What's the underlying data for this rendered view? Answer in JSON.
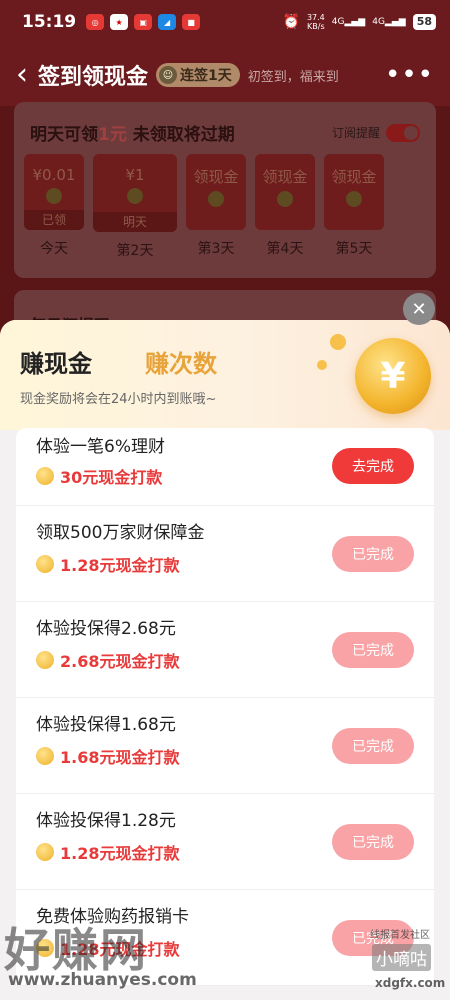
{
  "status_bar": {
    "time": "15:19",
    "network_speed": "37.4",
    "network_unit": "KB/s",
    "signal1": "4G",
    "signal2": "4G",
    "battery": "58"
  },
  "nav": {
    "title": "签到领现金",
    "streak": "连签1天",
    "slogan": "初签到，福来到"
  },
  "checkin": {
    "title_prefix": "明天可领",
    "title_amount": "1元",
    "title_suffix": " 未领取将过期",
    "remind_label": "订阅提醒",
    "days": [
      {
        "amount": "¥0.01",
        "foot": "已领",
        "label": "今天"
      },
      {
        "amount": "¥1",
        "foot": "明天",
        "label": "第2天"
      },
      {
        "amount": "领现金",
        "foot": "",
        "label": "第3天"
      },
      {
        "amount": "领现金",
        "foot": "",
        "label": "第4天"
      },
      {
        "amount": "领现金",
        "foot": "",
        "label": "第5天"
      }
    ],
    "section2_title": "每日狂提现"
  },
  "sheet": {
    "tab_cash": "赚现金",
    "tab_times": "赚次数",
    "subtitle": "现金奖励将会在24小时内到账哦~",
    "tasks": [
      {
        "title": "体验一笔6%理财",
        "reward": "30元现金打款",
        "button": "去完成"
      },
      {
        "title": "领取500万家财保障金",
        "reward": "1.28元现金打款",
        "button": "已完成"
      },
      {
        "title": "体验投保得2.68元",
        "reward": "2.68元现金打款",
        "button": "已完成"
      },
      {
        "title": "体验投保得1.68元",
        "reward": "1.68元现金打款",
        "button": "已完成"
      },
      {
        "title": "体验投保得1.28元",
        "reward": "1.28元现金打款",
        "button": "已完成"
      },
      {
        "title": "免费体验购药报销卡",
        "reward": "1.28元现金打款",
        "button": "已完成"
      }
    ]
  },
  "watermark": {
    "big": "好赚网",
    "url": "www.zhuanyes.com",
    "right_top": "线报首发社区",
    "right_mid": "小嘀咕",
    "right_url": "xdgfx.com"
  },
  "colors": {
    "primary_red": "#f03a3a",
    "done_pink": "#f9a3a6",
    "reward_red": "#e83a3a",
    "header_dark_red": "#6b1b1d"
  }
}
